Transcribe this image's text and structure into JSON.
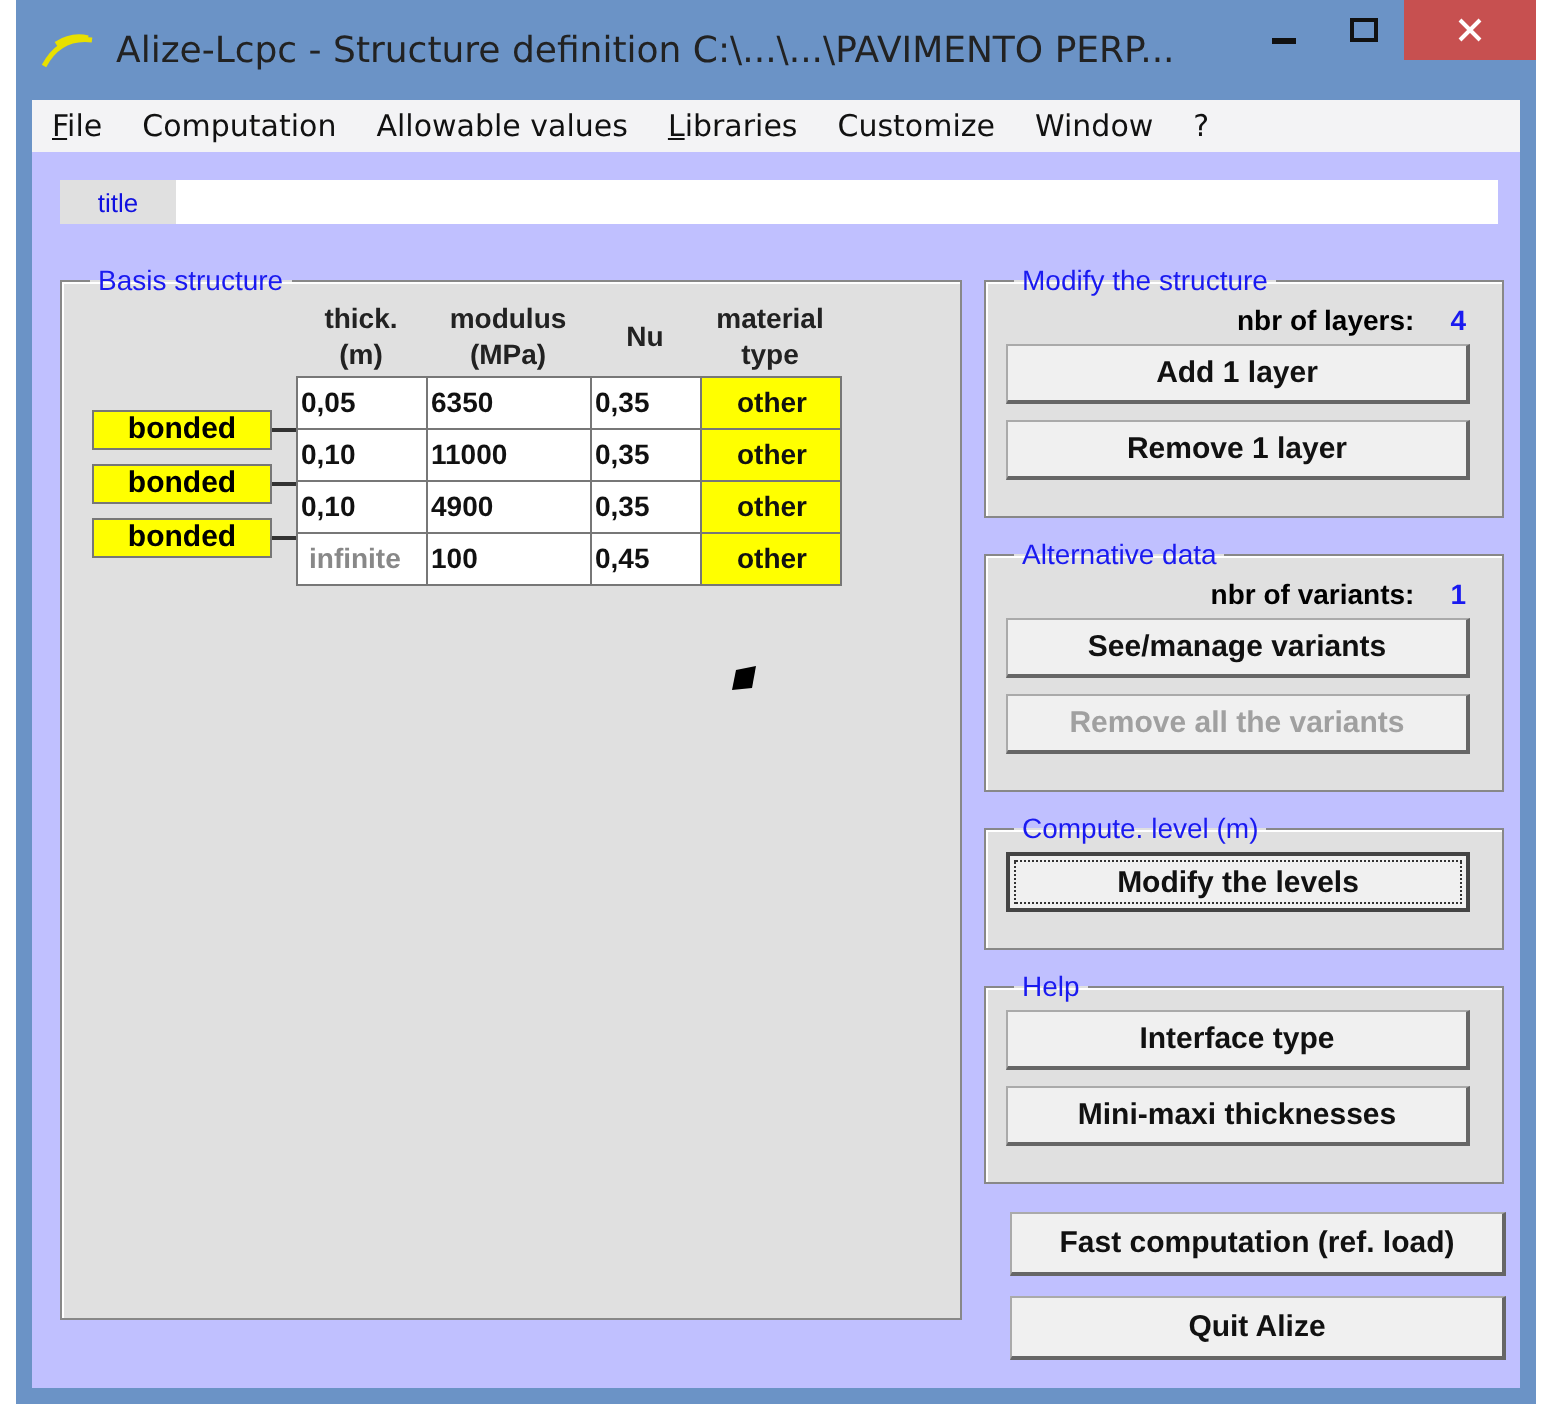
{
  "window": {
    "title": "Alize-Lcpc - Structure definition C:\\...\\...\\PAVIMENTO PERP..."
  },
  "menu": [
    {
      "label": "File",
      "underline_first": true
    },
    {
      "label": "Computation",
      "underline_first": false
    },
    {
      "label": "Allowable values",
      "underline_first": false
    },
    {
      "label": "Libraries",
      "underline_first": true
    },
    {
      "label": "Customize",
      "underline_first": false
    },
    {
      "label": "Window",
      "underline_first": false
    },
    {
      "label": "?",
      "underline_first": false
    }
  ],
  "title_field": {
    "label": "title"
  },
  "basis_structure": {
    "legend": "Basis structure",
    "columns": [
      "thick.\n(m)",
      "modulus\n(MPa)",
      "Nu",
      "material\ntype"
    ],
    "layers": [
      {
        "thickness": "0,05",
        "thickness_default": false,
        "modulus": "6350",
        "nu": "0,35",
        "material": "other"
      },
      {
        "thickness": "0,10",
        "thickness_default": false,
        "modulus": "11000",
        "nu": "0,35",
        "material": "other"
      },
      {
        "thickness": "0,10",
        "thickness_default": false,
        "modulus": "4900",
        "nu": "0,35",
        "material": "other"
      },
      {
        "thickness": "infinite",
        "thickness_default": true,
        "modulus": "100",
        "nu": "0,45",
        "material": "other"
      }
    ],
    "interfaces": [
      "bonded",
      "bonded",
      "bonded"
    ]
  },
  "groups": [
    {
      "legend": "Modify the structure",
      "count_label": "nbr of layers:",
      "count": "4",
      "buttons": [
        {
          "label": "Add 1 layer",
          "disabled": false,
          "focused": false
        },
        {
          "label": "Remove 1 layer",
          "disabled": false,
          "focused": false
        }
      ]
    },
    {
      "legend": "Alternative data",
      "count_label": "nbr of variants:",
      "count": "1",
      "buttons": [
        {
          "label": "See/manage variants",
          "disabled": false,
          "focused": false
        },
        {
          "label": "Remove all the variants",
          "disabled": true,
          "focused": false
        }
      ]
    },
    {
      "legend": "Compute. level (m)",
      "buttons": [
        {
          "label": "Modify the levels",
          "disabled": false,
          "focused": true
        }
      ]
    },
    {
      "legend": "Help",
      "buttons": [
        {
          "label": "Interface type",
          "disabled": false,
          "focused": false
        },
        {
          "label": "Mini-maxi thicknesses",
          "disabled": false,
          "focused": false
        }
      ]
    }
  ],
  "actions": [
    {
      "label": "Fast computation (ref. load)",
      "disabled": false,
      "focused": false
    },
    {
      "label": "Quit Alize",
      "disabled": false,
      "focused": false
    }
  ]
}
